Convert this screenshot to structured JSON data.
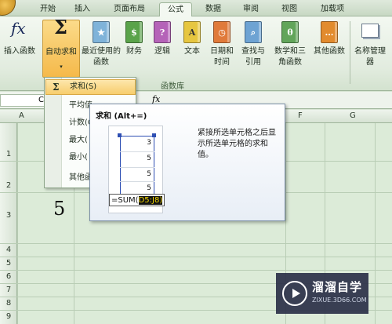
{
  "tabs": [
    {
      "label": "开始",
      "active": false
    },
    {
      "label": "插入",
      "active": false
    },
    {
      "label": "页面布局",
      "active": false
    },
    {
      "label": "公式",
      "active": true
    },
    {
      "label": "数据",
      "active": false
    },
    {
      "label": "审阅",
      "active": false
    },
    {
      "label": "视图",
      "active": false
    },
    {
      "label": "加载项",
      "active": false
    }
  ],
  "ribbon": {
    "group_label": "函数库",
    "buttons": [
      {
        "label": "插入函数",
        "icon": "fx-icon"
      },
      {
        "label": "自动求和",
        "icon": "sigma-icon"
      },
      {
        "label": "最近使用的函数",
        "icon": "recent-book-icon"
      },
      {
        "label": "财务",
        "icon": "finance-book-icon"
      },
      {
        "label": "逻辑",
        "icon": "logic-book-icon"
      },
      {
        "label": "文本",
        "icon": "text-book-icon"
      },
      {
        "label": "日期和时间",
        "icon": "date-book-icon"
      },
      {
        "label": "查找与引用",
        "icon": "lookup-book-icon"
      },
      {
        "label": "数学和三角函数",
        "icon": "math-book-icon"
      },
      {
        "label": "其他函数",
        "icon": "more-book-icon"
      },
      {
        "label": "名称管理器",
        "icon": "name-manager-icon"
      }
    ]
  },
  "formula_bar": {
    "namebox": "C",
    "fx": "fx"
  },
  "columns": [
    "A",
    "F",
    "G"
  ],
  "rows": [
    "1",
    "2",
    "3",
    "4",
    "5",
    "6",
    "7",
    "8",
    "9"
  ],
  "cell_value": "5",
  "menu": {
    "items": [
      "求和(S)",
      "平均值",
      "计数(C)",
      "最大(",
      "最小(",
      "其他函"
    ]
  },
  "tooltip": {
    "title": "求和 (Alt+=)",
    "description": "紧接所选单元格之后显示所选单元格的求和值。",
    "values": [
      "3",
      "5",
      "5",
      "5"
    ],
    "formula_prefix": "=SUM(",
    "formula_highlight": "D5:J8)"
  },
  "watermark": {
    "title": "溜溜自学",
    "subtitle": "ZIXUE.3D66.COM"
  }
}
